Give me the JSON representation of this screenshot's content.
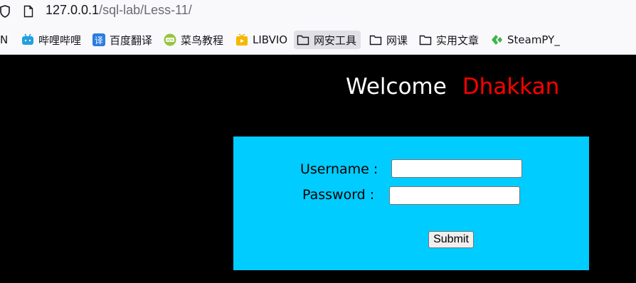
{
  "browser": {
    "url_host": "127.0.0.1",
    "url_path": "/sql-lab/Less-11/",
    "bookmarks": [
      {
        "label": "N",
        "icon": "partial-icon"
      },
      {
        "label": "哔哩哔哩",
        "icon": "bilibili-icon"
      },
      {
        "label": "百度翻译",
        "icon": "baidu-translate-icon"
      },
      {
        "label": "菜鸟教程",
        "icon": "runoob-icon"
      },
      {
        "label": "LIBVIO",
        "icon": "libvio-icon"
      },
      {
        "label": "网安工具",
        "icon": "folder-icon"
      },
      {
        "label": "网课",
        "icon": "folder-icon"
      },
      {
        "label": "实用文章",
        "icon": "folder-icon"
      },
      {
        "label": "SteamPY_",
        "icon": "steampy-icon"
      }
    ]
  },
  "page": {
    "welcome_text": "Welcome",
    "welcome_name": "Dhakkan",
    "form": {
      "username_label": "Username :",
      "password_label": "Password :",
      "username_value": "",
      "password_value": "",
      "submit_label": "Submit"
    }
  },
  "colors": {
    "background": "#000000",
    "form_background": "#00ccff",
    "name_color": "#ff0000"
  }
}
